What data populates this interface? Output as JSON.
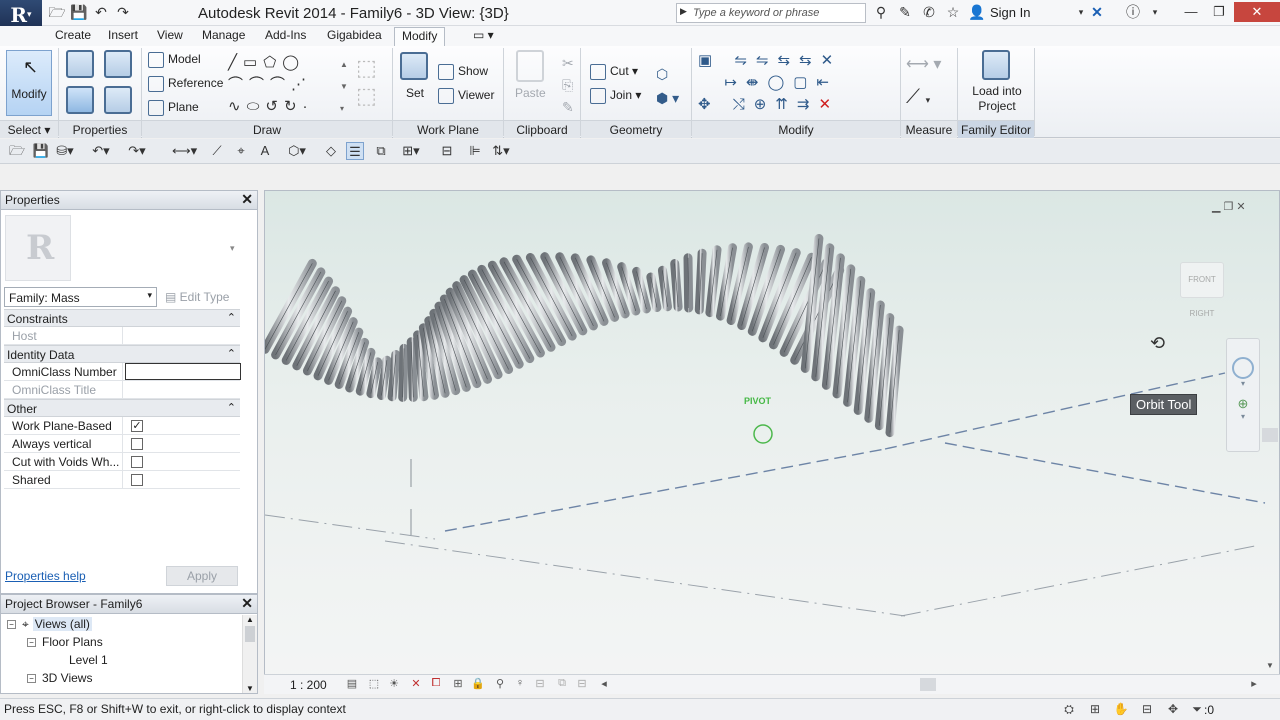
{
  "window": {
    "title": "Autodesk Revit 2014 -    Family6 - 3D View: {3D}",
    "logo_text": "R",
    "search_placeholder": "Type a keyword or phrase",
    "sign_in": "Sign In"
  },
  "tabs": [
    "Create",
    "Insert",
    "View",
    "Manage",
    "Add-Ins",
    "Gigabidea",
    "Modify"
  ],
  "active_tab": "Modify",
  "ribbon": {
    "select": {
      "modify_label": "Modify",
      "title": "Select"
    },
    "properties": {
      "title": "Properties"
    },
    "draw": {
      "model": "Model",
      "reference": "Reference",
      "plane": "Plane",
      "title": "Draw"
    },
    "work_plane": {
      "set": "Set",
      "show": "Show",
      "viewer": "Viewer",
      "title": "Work Plane"
    },
    "clipboard": {
      "paste": "Paste",
      "title": "Clipboard"
    },
    "geometry": {
      "cut": "Cut",
      "join": "Join",
      "title": "Geometry"
    },
    "modify": {
      "title": "Modify"
    },
    "measure": {
      "title": "Measure"
    },
    "family_editor": {
      "load_into_project": "Load into Project",
      "title": "Family Editor"
    }
  },
  "properties": {
    "header": "Properties",
    "family_select": "Family: Mass",
    "edit_type": "Edit Type",
    "groups": [
      {
        "name": "Constraints",
        "rows": [
          {
            "name": "Host",
            "value": "",
            "dim": true
          }
        ]
      },
      {
        "name": "Identity Data",
        "rows": [
          {
            "name": "OmniClass Number",
            "value": ""
          },
          {
            "name": "OmniClass Title",
            "value": "",
            "dim": true
          }
        ]
      },
      {
        "name": "Other",
        "rows": [
          {
            "name": "Work Plane-Based",
            "checked": true
          },
          {
            "name": "Always vertical",
            "checked": false
          },
          {
            "name": "Cut with Voids Wh...",
            "checked": false
          },
          {
            "name": "Shared",
            "checked": false
          }
        ]
      }
    ],
    "help_link": "Properties help",
    "apply": "Apply"
  },
  "project_browser": {
    "header": "Project Browser - Family6",
    "items": [
      {
        "label": "Views (all)",
        "level": 0,
        "toggle": "−",
        "selected": true
      },
      {
        "label": "Floor Plans",
        "level": 1,
        "toggle": "−"
      },
      {
        "label": "Level 1",
        "level": 2,
        "toggle": ""
      },
      {
        "label": "3D Views",
        "level": 1,
        "toggle": "−"
      }
    ]
  },
  "viewport": {
    "tooltip": "Orbit Tool",
    "pivot_label": "PIVOT",
    "viewcube_text": "FRONT RIGHT"
  },
  "view_control_bar": {
    "scale": "1 : 200"
  },
  "status_bar": {
    "message": "Press ESC, F8 or Shift+W to exit, or right-click to display context",
    "filter_count": ":0"
  },
  "colors": {
    "accent": "#4a6d94",
    "active_tab_bg": "#fbfcfd",
    "tooltip_bg": "#5b5f63",
    "close_button": "#c7463e"
  }
}
